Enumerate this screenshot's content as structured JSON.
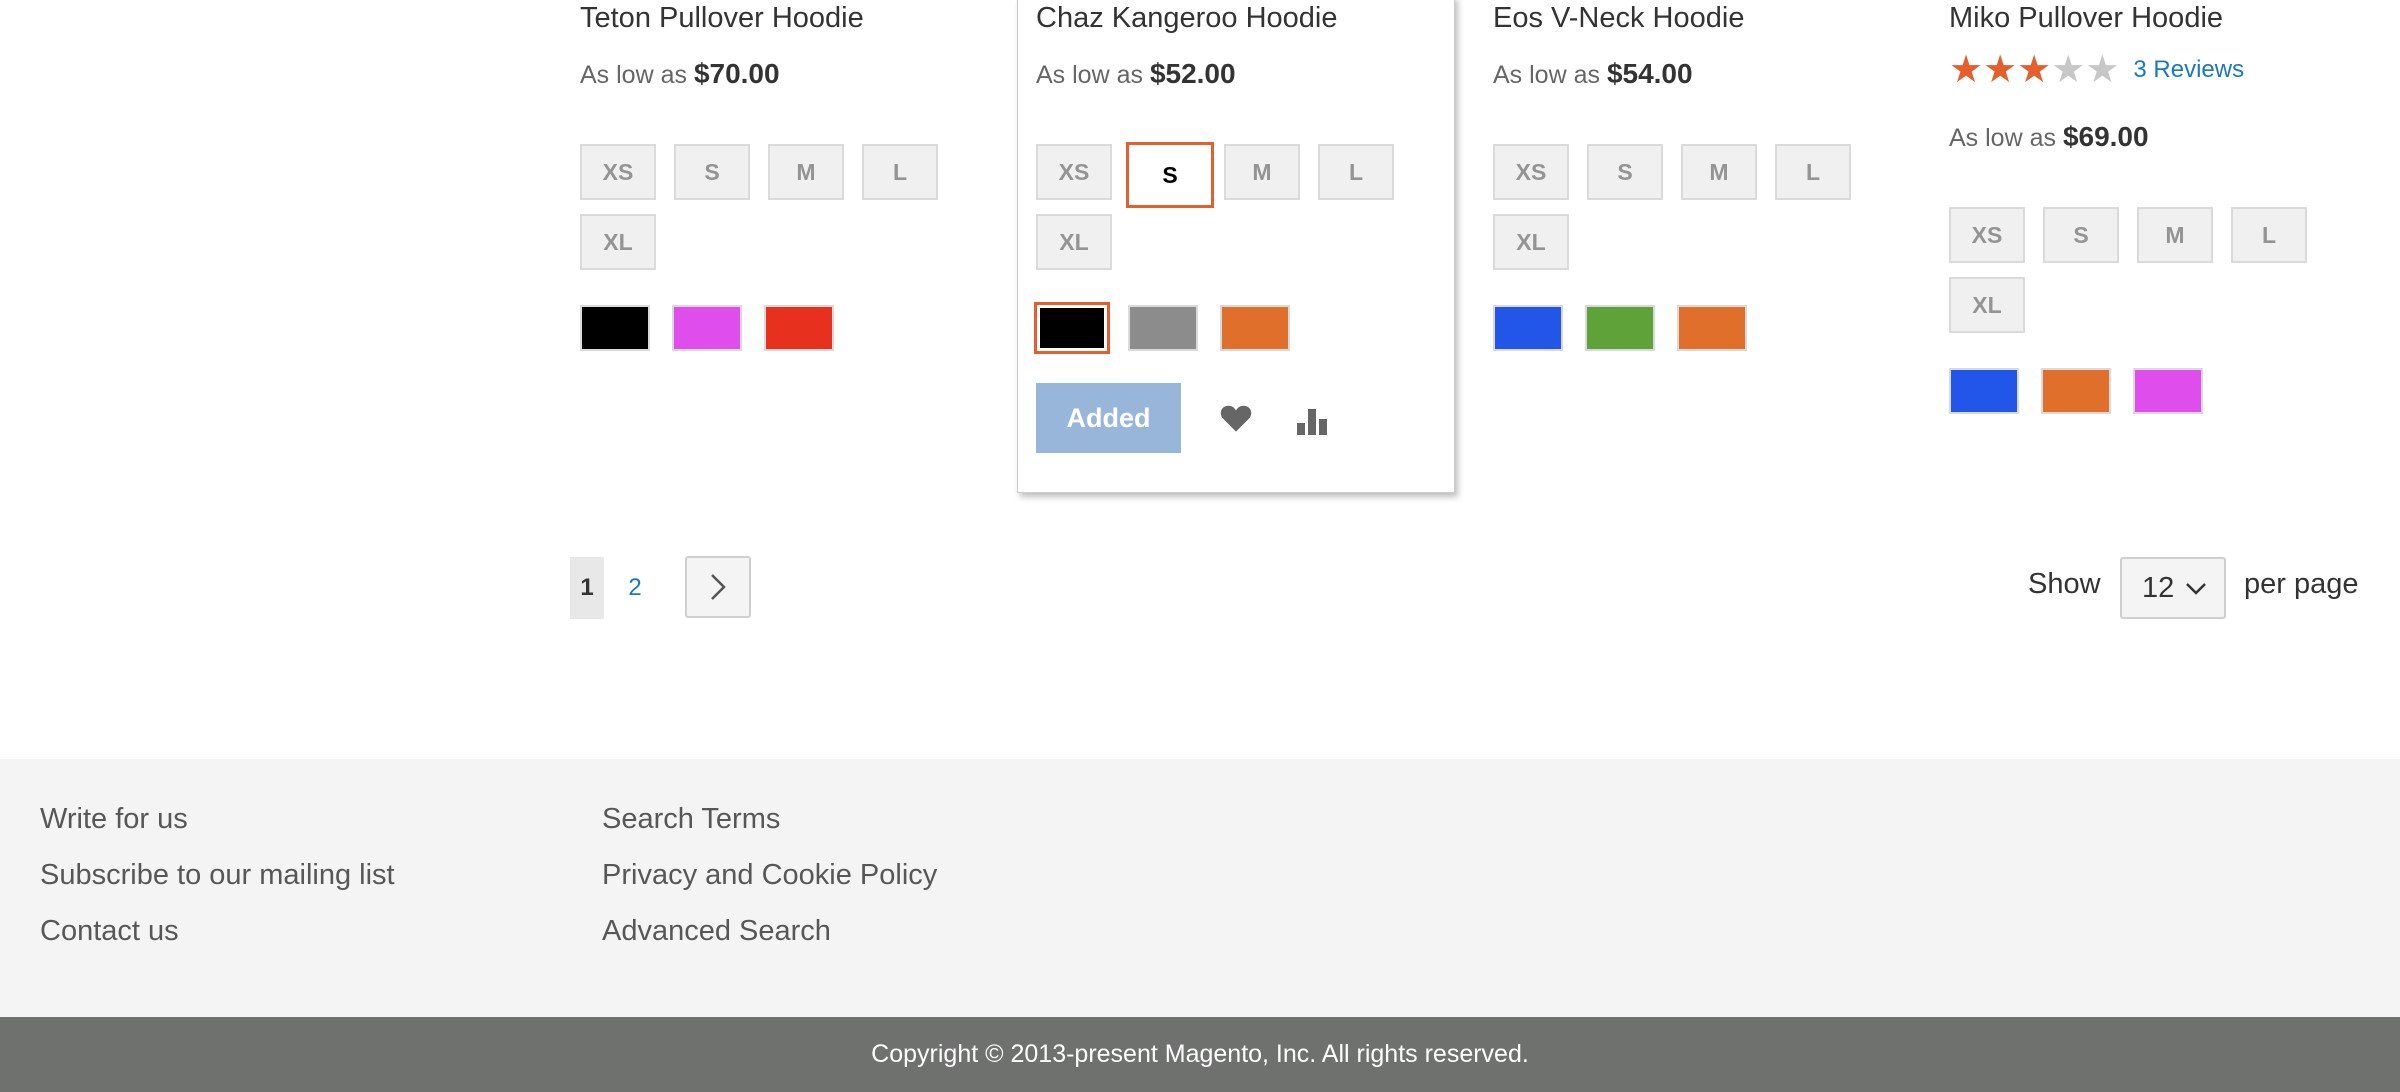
{
  "products": [
    {
      "name": "Teton Pullover Hoodie",
      "price_prefix": "As low as",
      "price": "$70.00",
      "sizes": [
        "XS",
        "S",
        "M",
        "L",
        "XL"
      ],
      "colors": [
        "#000000",
        "#e04ded",
        "#e8301f"
      ]
    },
    {
      "name": "Chaz Kangeroo Hoodie",
      "price_prefix": "As low as",
      "price": "$52.00",
      "sizes": [
        "XS",
        "S",
        "M",
        "L",
        "XL"
      ],
      "selected_size": "S",
      "colors": [
        "#000000",
        "#8c8c8c",
        "#e06f2c"
      ],
      "selected_color_index": 0,
      "add_button_label": "Added",
      "wishlist_icon": "heart-icon",
      "compare_icon": "bar-chart-icon"
    },
    {
      "name": "Eos V-Neck Hoodie",
      "price_prefix": "As low as",
      "price": "$54.00",
      "sizes": [
        "XS",
        "S",
        "M",
        "L",
        "XL"
      ],
      "colors": [
        "#2156e8",
        "#60a23a",
        "#e06f2c"
      ]
    },
    {
      "name": "Miko Pullover Hoodie",
      "rating": 3,
      "rating_max": 5,
      "reviews_label": "3 Reviews",
      "price_prefix": "As low as",
      "price": "$69.00",
      "sizes": [
        "XS",
        "S",
        "M",
        "L",
        "XL"
      ],
      "colors": [
        "#2156e8",
        "#e06f2c",
        "#e04ded"
      ]
    }
  ],
  "pager": {
    "current": "1",
    "next_page": "2",
    "next_icon": "chevron-right-icon"
  },
  "limiter": {
    "show_label": "Show",
    "value": "12",
    "per_page_label": "per page"
  },
  "footer": {
    "col1": [
      "Write for us",
      "Subscribe to our mailing list",
      "Contact us"
    ],
    "col2": [
      "Search Terms",
      "Privacy and Cookie Policy",
      "Advanced Search"
    ]
  },
  "copyright": "Copyright © 2013-present Magento, Inc. All rights reserved.",
  "colors": {
    "accent": "#e65e2e",
    "link": "#1979c3",
    "star_filled": "#e65e2e",
    "star_empty": "#c7c7c7",
    "added_button": "#98b6d9"
  }
}
